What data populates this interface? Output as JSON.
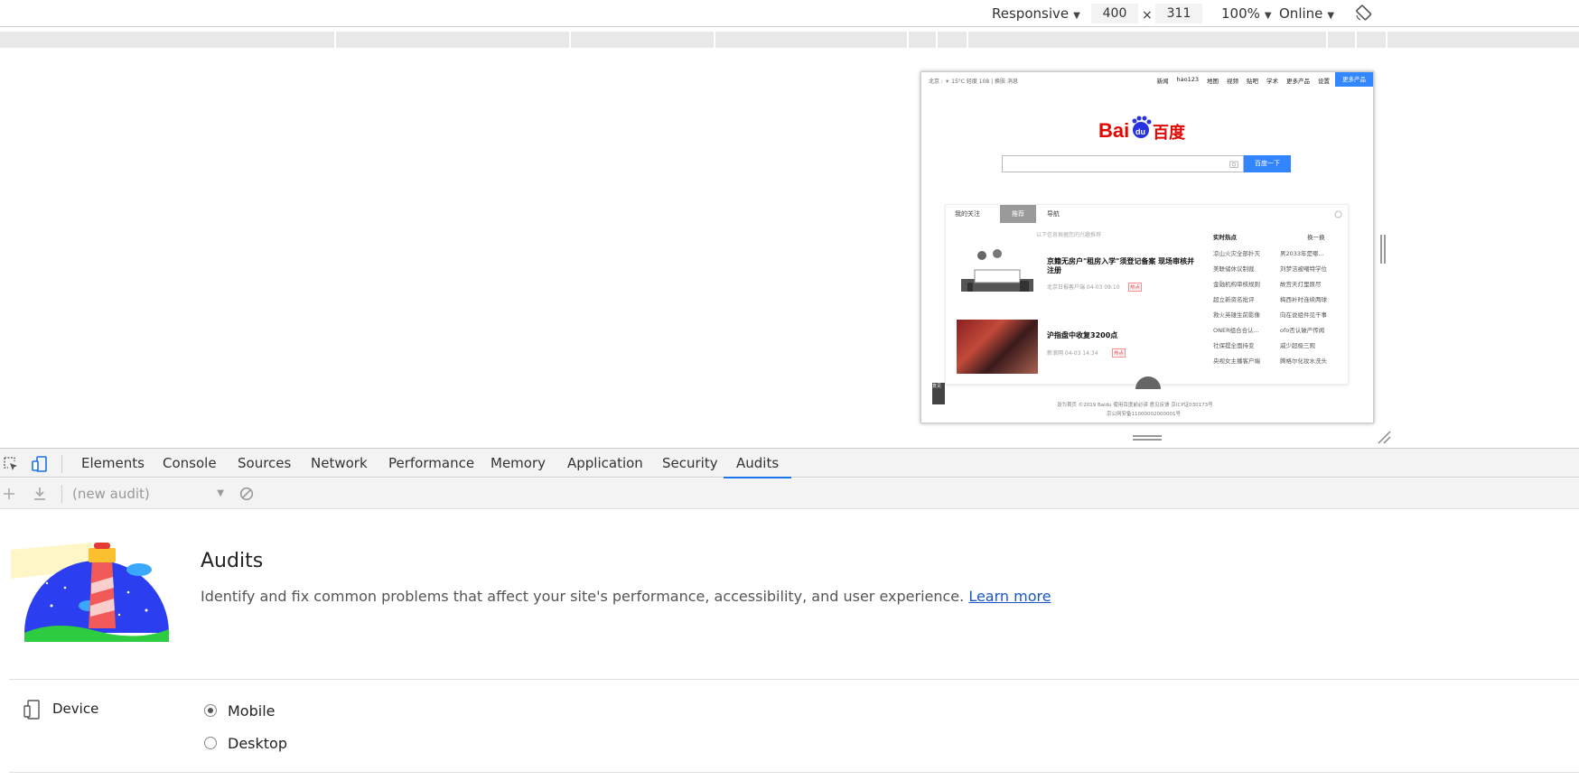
{
  "device_toolbar": {
    "mode": "Responsive",
    "width": "400",
    "times": "×",
    "height": "311",
    "zoom": "100%",
    "network": "Online"
  },
  "baidu": {
    "weather": "北京 : ☀ 15°C 轻度 108 | 换肤 消息",
    "nav": [
      "新闻",
      "hao123",
      "地图",
      "视频",
      "贴吧",
      "学术",
      "更多产品",
      "设置"
    ],
    "login": "更多产品",
    "search_btn": "百度一下",
    "tabs": [
      "我的关注",
      "推荐",
      "导航"
    ],
    "feed_note": "以下信息根据您的兴趣推荐",
    "news": [
      {
        "title": "京籍无房户\"租房入学\"须登记备案 现场审核并注册",
        "meta": "北京日报客户端  04-03 09:10",
        "tag": "热点"
      },
      {
        "title": "沪指盘中收复3200点",
        "meta": "新浪网  04-03 14:34",
        "tag": "热点"
      }
    ],
    "hot_title": "实时热点",
    "hot_refresh": "换一换",
    "hot_left": [
      "凉山火灾全部扑灭",
      "美联储休议制裁",
      "金融机构审核规则",
      "超立新资名批评",
      "救火英雄生前影像",
      "ONER组合合认...",
      "社保提全面持变",
      "央视女主播客户端"
    ],
    "hot_right": [
      "男2033年是哪...",
      "刘梦洁被嘲特学位",
      "故宫天灯里原尽",
      "梅西补时连续两球",
      "向在说组件见干事",
      "ofo否认破产传闻",
      "戚少超极三观",
      "腾格尔化妆水洗头"
    ],
    "footer": "设为首页  ©2019 Baidu 使用百度前必读 意见反馈 京ICP证030173号",
    "footer2": "京公网安备11000002000001号",
    "side": "意见"
  },
  "devtools_tabs": [
    "Elements",
    "Console",
    "Sources",
    "Network",
    "Performance",
    "Memory",
    "Application",
    "Security",
    "Audits"
  ],
  "active_tab": "Audits",
  "audits_toolbar": {
    "select_value": "(new audit)"
  },
  "audits": {
    "title": "Audits",
    "description": "Identify and fix common problems that affect your site's performance, accessibility, and user experience.",
    "learn_more": "Learn more",
    "device_label": "Device",
    "options": [
      "Mobile",
      "Desktop"
    ],
    "selected_option": "Mobile"
  },
  "colors": {
    "accent": "#1a73e8",
    "baidu_blue": "#3385ff",
    "baidu_red": "#e10601",
    "link": "#1a56c4"
  }
}
